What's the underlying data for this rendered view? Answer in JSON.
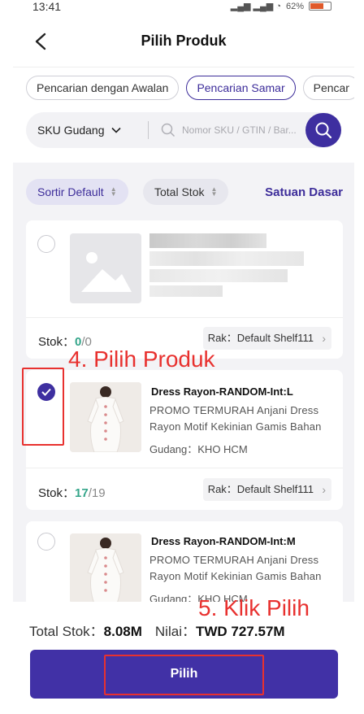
{
  "status_bar": {
    "time": "13:41",
    "battery": "62%"
  },
  "header": {
    "title": "Pilih Produk"
  },
  "search_tabs": [
    {
      "label": "Pencarian dengan Awalan",
      "active": false
    },
    {
      "label": "Pencarian Samar",
      "active": true
    },
    {
      "label": "Pencar",
      "active": false
    }
  ],
  "search": {
    "field_select": "SKU Gudang",
    "placeholder": "Nomor SKU / GTIN / Bar..."
  },
  "toolbar": {
    "sort_label": "Sortir Default",
    "stock_sort_label": "Total Stok",
    "unit_link": "Satuan Dasar"
  },
  "products": [
    {
      "name": "",
      "desc": "",
      "warehouse": "",
      "stock_label": "Stok",
      "stock_available": "0",
      "stock_total": "/0",
      "rack": "Rak：Default Shelf111",
      "checked": false
    },
    {
      "name": "Dress Rayon-RANDOM-Int:L",
      "desc": "PROMO TERMURAH Anjani Dress Rayon Motif Kekinian Gamis Bahan",
      "warehouse": "Gudang：KHO HCM",
      "stock_label": "Stok",
      "stock_available": "17",
      "stock_total": "/19",
      "rack": "Rak：Default Shelf111",
      "checked": true
    },
    {
      "name": "Dress Rayon-RANDOM-Int:M",
      "desc": "PROMO TERMURAH Anjani Dress Rayon Motif Kekinian Gamis Bahan",
      "warehouse": "Gudang：KHO HCM",
      "checked": false
    }
  ],
  "footer": {
    "total_stock_label": "Total Stok：",
    "total_stock_value": "8.08M",
    "value_label": "Nilai：",
    "value_amount": "TWD 727.57M",
    "pick_button": "Pilih"
  },
  "annotations": {
    "step4": "4. Pilih Produk",
    "step5": "5. Klik Pilih"
  },
  "colors": {
    "primary": "#4131a6",
    "stock_green": "#34a58a",
    "annotation_red": "#e8312f"
  }
}
